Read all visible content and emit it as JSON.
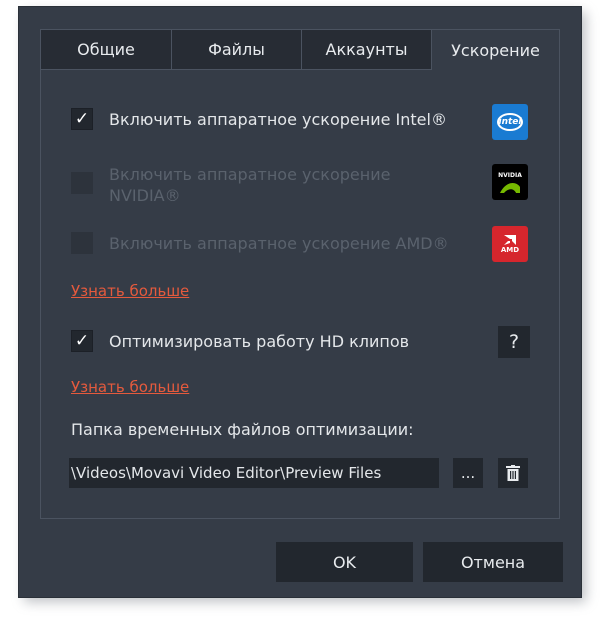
{
  "tabs": [
    {
      "label": "Общие",
      "active": false
    },
    {
      "label": "Файлы",
      "active": false
    },
    {
      "label": "Аккаунты",
      "active": false
    },
    {
      "label": "Ускорение",
      "active": true
    }
  ],
  "acceleration": {
    "intel": {
      "label": "Включить аппаратное ускорение Intel®",
      "checked": true,
      "enabled": true,
      "logo_text": "intel"
    },
    "nvidia": {
      "label": "Включить аппаратное ускорение NVIDIA®",
      "checked": false,
      "enabled": false,
      "logo_text": "NVIDIA"
    },
    "amd": {
      "label": "Включить аппаратное ускорение AMD®",
      "checked": false,
      "enabled": false,
      "logo_text": "AMD"
    },
    "learn_more": "Узнать больше"
  },
  "optimize_hd": {
    "label": "Оптимизировать работу HD клипов",
    "checked": true,
    "help": "?",
    "learn_more": "Узнать больше"
  },
  "temp_folder": {
    "label": "Папка временных файлов оптимизации:",
    "path": "\\Videos\\Movavi Video Editor\\Preview Files",
    "browse": "...",
    "delete_icon": "trash-icon"
  },
  "buttons": {
    "ok": "OK",
    "cancel": "Отмена"
  },
  "colors": {
    "dialog_bg": "#353c47",
    "link": "#e55a3d",
    "intel_blue": "#1a7bd2",
    "amd_red": "#d6262d",
    "nvidia_green": "#76b900"
  }
}
